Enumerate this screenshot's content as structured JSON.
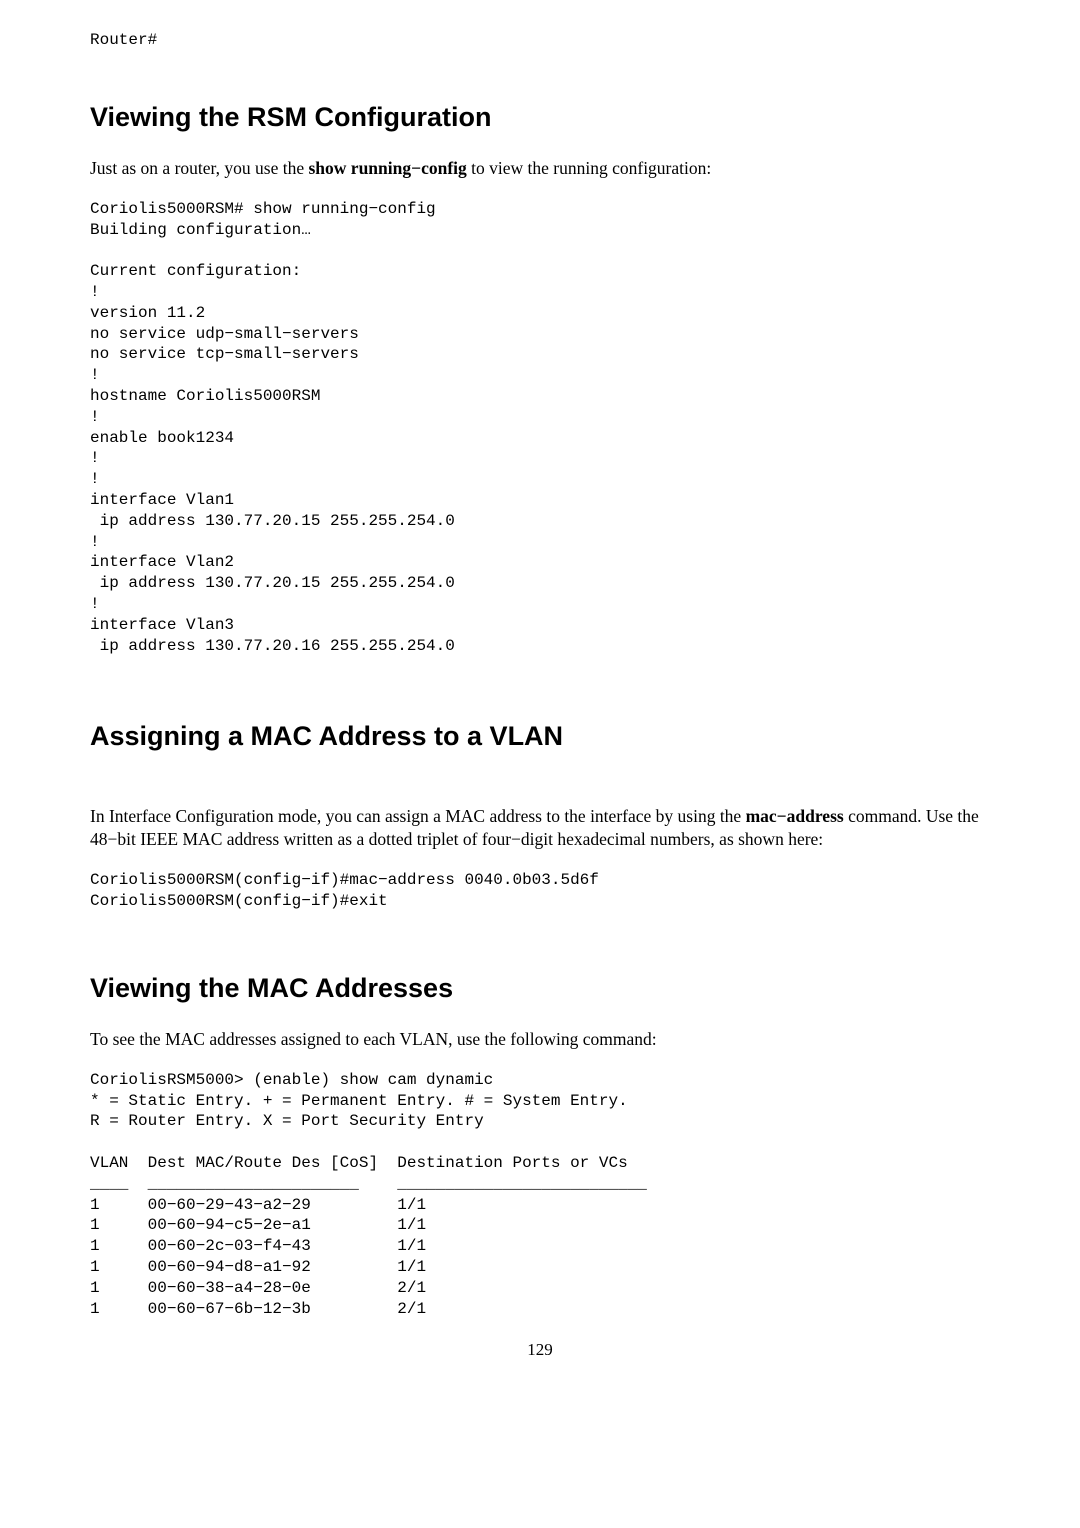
{
  "topLine": "Router#",
  "section1": {
    "heading": "Viewing the RSM Configuration",
    "intro_before": "Just as on a router, you use the ",
    "intro_bold": "show running−config",
    "intro_after": " to view the running configuration:",
    "code": "Coriolis5000RSM# show running−config\nBuilding configuration…\n\nCurrent configuration:\n!\nversion 11.2\nno service udp−small−servers\nno service tcp−small−servers\n!\nhostname Coriolis5000RSM\n!\nenable book1234\n!\n!\ninterface Vlan1\n ip address 130.77.20.15 255.255.254.0\n!\ninterface Vlan2\n ip address 130.77.20.15 255.255.254.0\n!\ninterface Vlan3\n ip address 130.77.20.16 255.255.254.0"
  },
  "section2": {
    "heading": "Assigning a MAC Address to a VLAN",
    "para_before": "In Interface Configuration mode, you can assign a MAC address to the interface by using the ",
    "para_bold": "mac−address",
    "para_after": " command. Use the 48−bit IEEE MAC address written as a dotted triplet of four−digit hexadecimal numbers, as shown here:",
    "code": "Coriolis5000RSM(config−if)#mac−address 0040.0b03.5d6f\nCoriolis5000RSM(config−if)#exit"
  },
  "section3": {
    "heading": "Viewing the MAC Addresses",
    "intro": "To see the MAC addresses assigned to each VLAN, use the following command:",
    "code": "CoriolisRSM5000> (enable) show cam dynamic\n* = Static Entry. + = Permanent Entry. # = System Entry.\nR = Router Entry. X = Port Security Entry\n\nVLAN  Dest MAC/Route Des [CoS]  Destination Ports or VCs\n____  ______________________    __________________________\n1     00−60−29−43−a2−29         1/1\n1     00−60−94−c5−2e−a1         1/1\n1     00−60−2c−03−f4−43         1/1\n1     00−60−94−d8−a1−92         1/1\n1     00−60−38−a4−28−0e         2/1\n1     00−60−67−6b−12−3b         2/1"
  },
  "pageNumber": "129"
}
